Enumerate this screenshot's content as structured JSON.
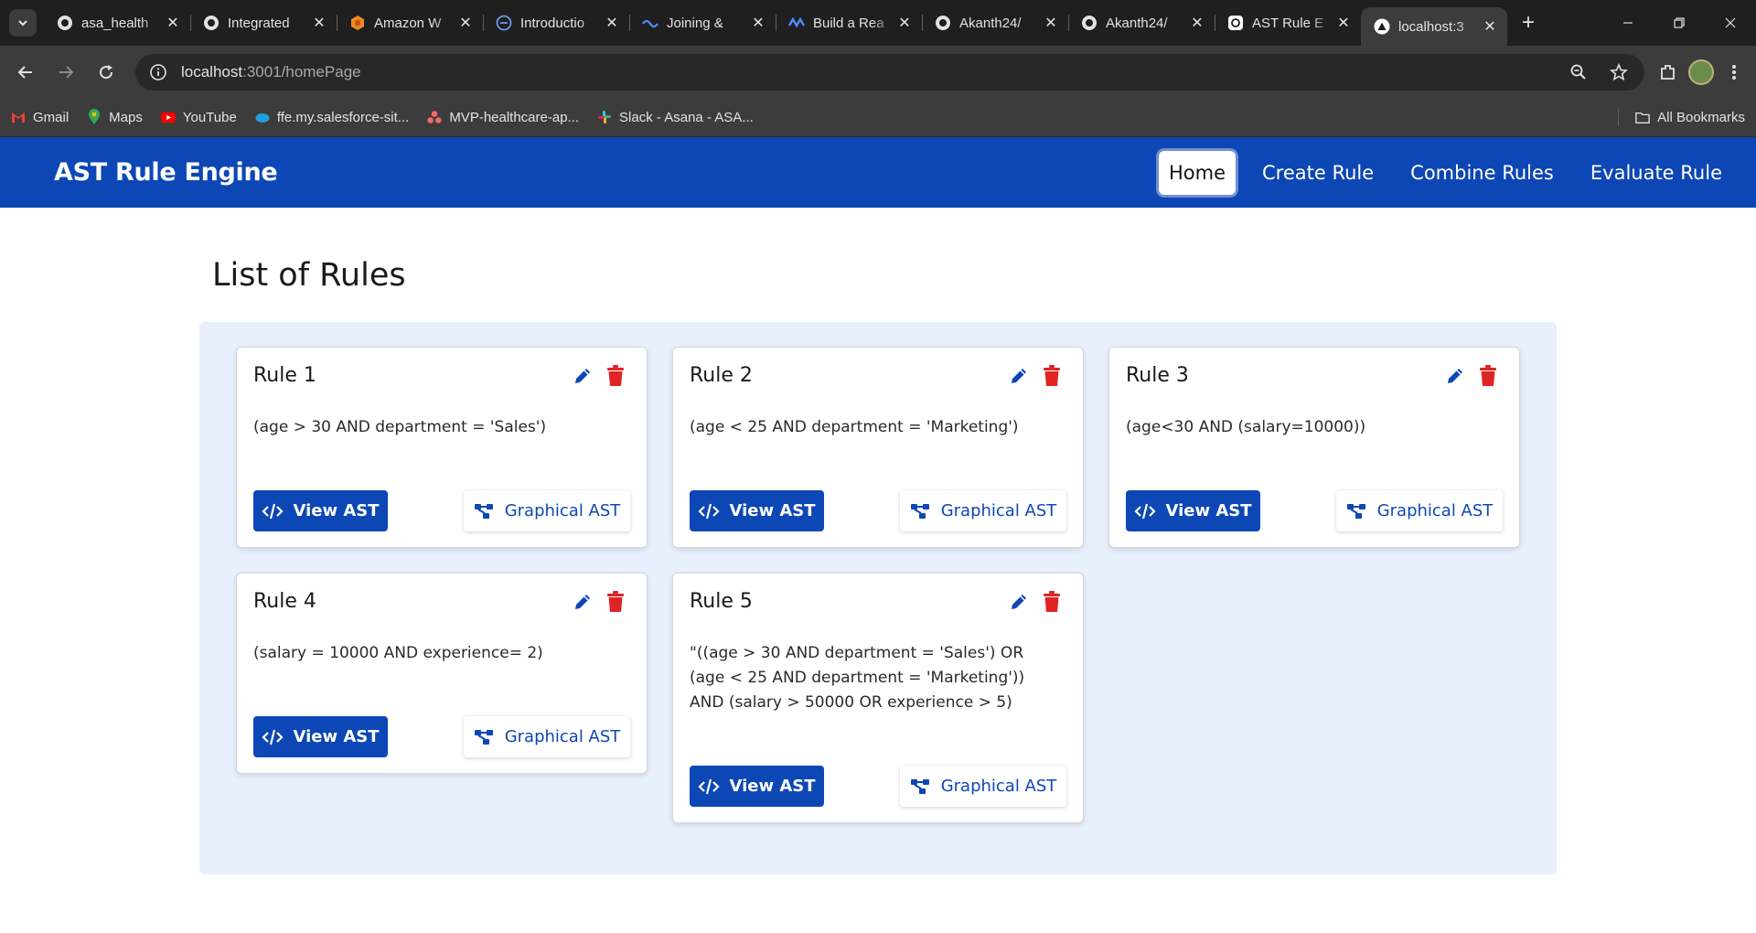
{
  "browser": {
    "tabs": [
      {
        "title": "asa_health",
        "icon": "github-icon"
      },
      {
        "title": "Integrated",
        "icon": "github-icon"
      },
      {
        "title": "Amazon W",
        "icon": "aws-icon"
      },
      {
        "title": "Introductio",
        "icon": "globe-icon"
      },
      {
        "title": "Joining & ",
        "icon": "wave-icon"
      },
      {
        "title": "Build a Rea",
        "icon": "wave-icon"
      },
      {
        "title": "Akanth24/",
        "icon": "github-icon"
      },
      {
        "title": "Akanth24/",
        "icon": "github-icon"
      },
      {
        "title": "AST Rule E",
        "icon": "openai-icon"
      },
      {
        "title": "localhost:3",
        "icon": "vercel-icon",
        "active": true
      }
    ],
    "url_host": "localhost",
    "url_rest": ":3001/homePage",
    "bookmarks": [
      {
        "label": "Gmail",
        "icon": "gmail-icon"
      },
      {
        "label": "Maps",
        "icon": "maps-icon"
      },
      {
        "label": "YouTube",
        "icon": "youtube-icon"
      },
      {
        "label": "ffe.my.salesforce-sit...",
        "icon": "salesforce-icon"
      },
      {
        "label": "MVP-healthcare-ap...",
        "icon": "asana-icon"
      },
      {
        "label": "Slack - Asana - ASA...",
        "icon": "slack-icon"
      }
    ],
    "all_bookmarks": "All Bookmarks"
  },
  "app": {
    "brand": "AST Rule Engine",
    "nav": [
      {
        "label": "Home",
        "active": true
      },
      {
        "label": "Create Rule"
      },
      {
        "label": "Combine Rules"
      },
      {
        "label": "Evaluate Rule"
      }
    ],
    "page_title": "List of Rules",
    "buttons": {
      "view_ast": "View AST",
      "graphical_ast": "Graphical AST"
    },
    "rules": [
      {
        "name": "Rule 1",
        "expression": "(age > 30 AND department = 'Sales')"
      },
      {
        "name": "Rule 2",
        "expression": "(age < 25 AND department = 'Marketing')"
      },
      {
        "name": "Rule 3",
        "expression": "(age<30 AND (salary=10000))"
      },
      {
        "name": "Rule 4",
        "expression": "(salary = 10000 AND experience= 2)"
      },
      {
        "name": "Rule 5",
        "expression": "\"((age > 30 AND department = 'Sales') OR (age < 25 AND department = 'Marketing')) AND (salary > 50000 OR experience > 5)"
      }
    ]
  },
  "colors": {
    "primary": "#0d47b5",
    "panel": "#e8f0fd",
    "delete": "#e02424"
  }
}
